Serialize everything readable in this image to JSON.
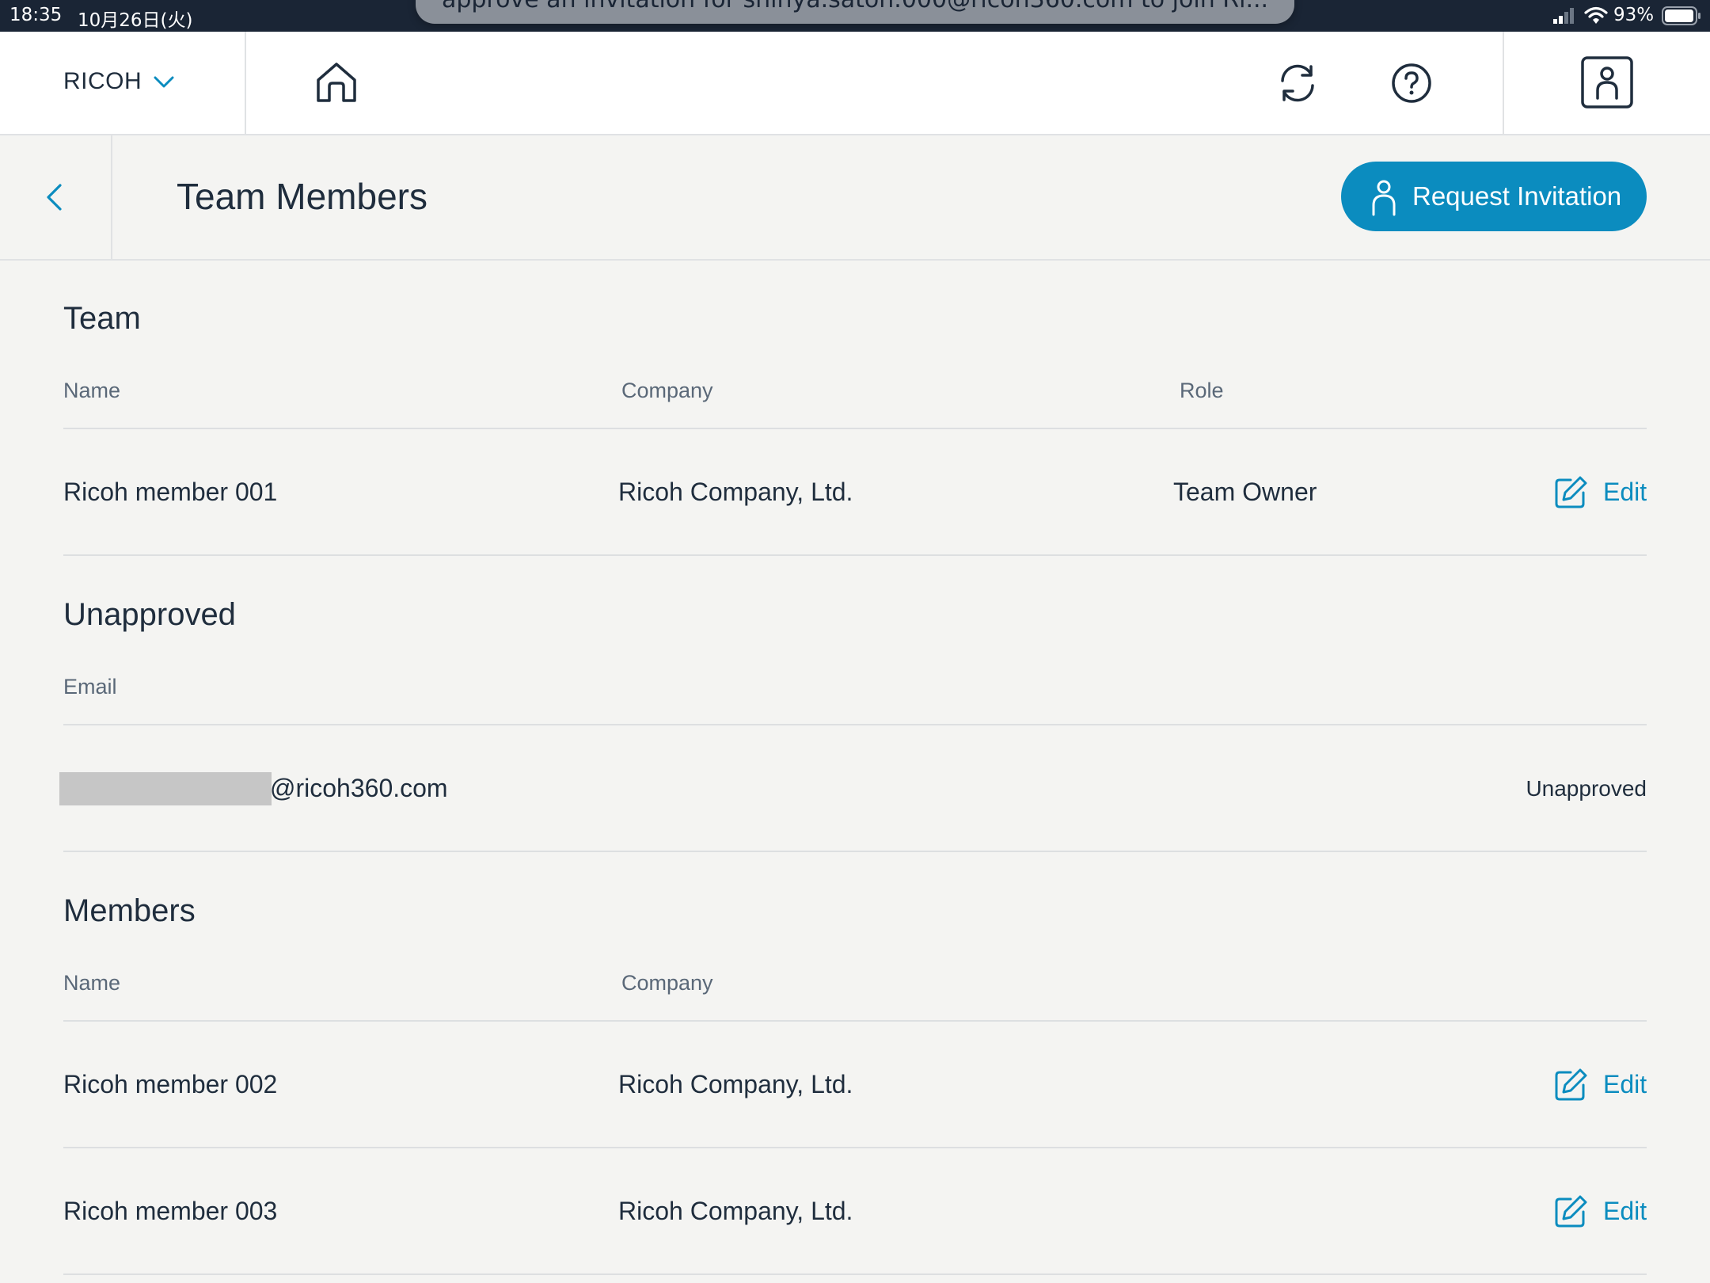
{
  "status_bar": {
    "time": "18:35",
    "date": "10月26日(火)",
    "banner_text": "approve an invitation for shinya.satoh.000@ricoh360.com to join Ri...",
    "battery": "93%"
  },
  "header": {
    "brand": "RICOH",
    "icons": [
      "home-icon",
      "sync-icon",
      "help-icon",
      "account-icon"
    ]
  },
  "page": {
    "title": "Team Members",
    "request_button": "Request Invitation"
  },
  "team": {
    "title": "Team",
    "columns": [
      "Name",
      "Company",
      "Role"
    ],
    "rows": [
      {
        "name": "Ricoh member 001",
        "company": "Ricoh Company, Ltd.",
        "role": "Team Owner",
        "action": "Edit"
      }
    ]
  },
  "unapproved": {
    "title": "Unapproved",
    "columns": [
      "Email"
    ],
    "rows": [
      {
        "email_suffix": "@ricoh360.com",
        "status": "Unapproved"
      }
    ]
  },
  "members": {
    "title": "Members",
    "columns": [
      "Name",
      "Company"
    ],
    "rows": [
      {
        "name": "Ricoh member 002",
        "company": "Ricoh Company, Ltd.",
        "action": "Edit"
      },
      {
        "name": "Ricoh member 003",
        "company": "Ricoh Company, Ltd.",
        "action": "Edit"
      }
    ]
  },
  "colors": {
    "accent": "#0b8cbf",
    "text": "#1f2d3d",
    "background": "#f4f4f2",
    "status_bar": "#1a2535"
  }
}
